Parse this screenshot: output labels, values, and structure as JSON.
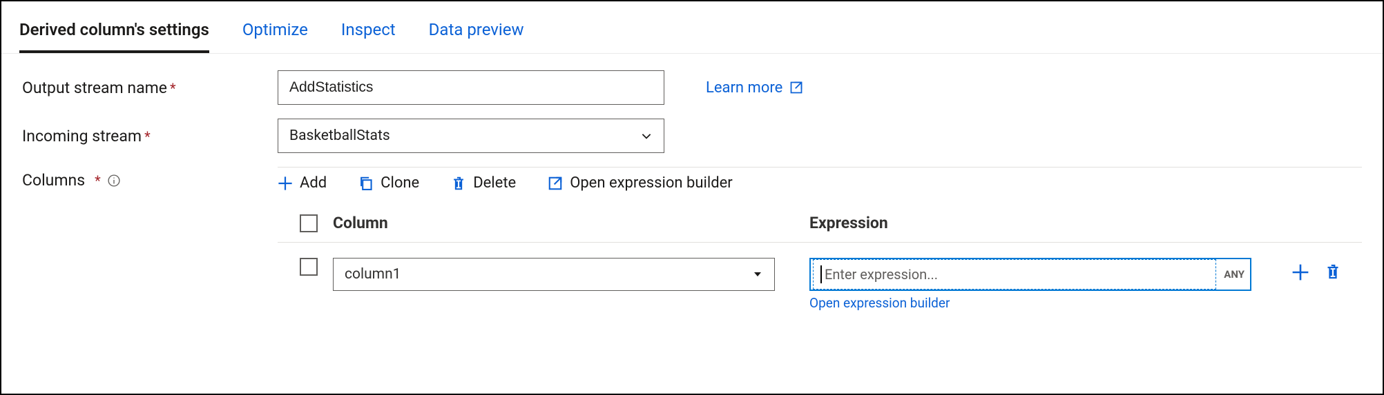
{
  "tabs": {
    "settings": "Derived column's settings",
    "optimize": "Optimize",
    "inspect": "Inspect",
    "preview": "Data preview"
  },
  "form": {
    "output_label": "Output stream name",
    "output_value": "AddStatistics",
    "learn_more": "Learn more",
    "incoming_label": "Incoming stream",
    "incoming_value": "BasketballStats",
    "columns_label": "Columns"
  },
  "commands": {
    "add": "Add",
    "clone": "Clone",
    "delete": "Delete",
    "open_builder": "Open expression builder"
  },
  "table": {
    "col_header": "Column",
    "expr_header": "Expression",
    "row": {
      "column_name": "column1",
      "expr_placeholder": "Enter expression...",
      "any_tag": "ANY",
      "open_builder_link": "Open expression builder"
    }
  }
}
